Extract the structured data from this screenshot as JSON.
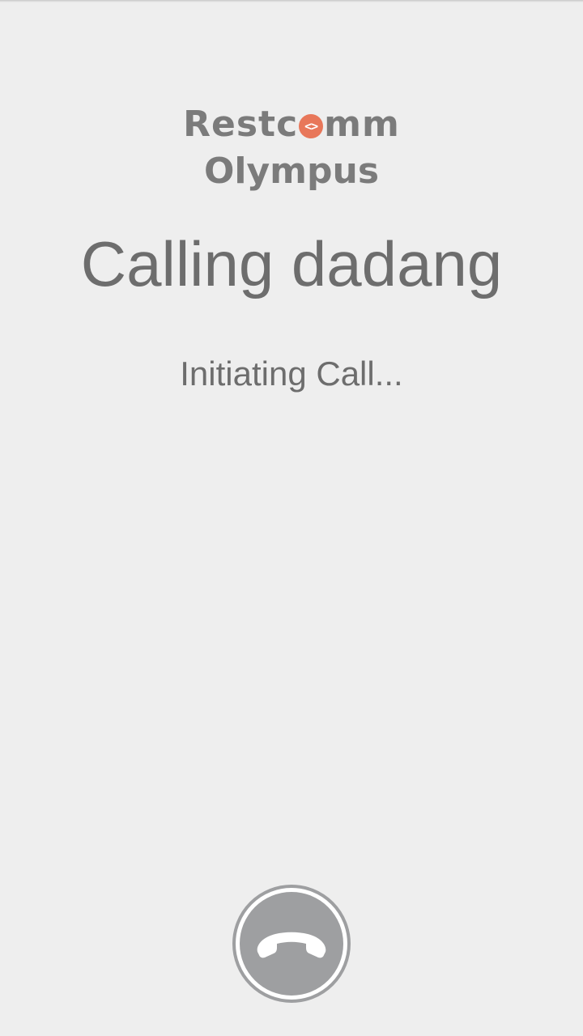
{
  "logo": {
    "line1_prefix": "Restc",
    "line1_mark": "<>",
    "line1_suffix": "mm",
    "line2": "Olympus",
    "mark_color": "#e8775a"
  },
  "call": {
    "title": "Calling dadang",
    "status": "Initiating Call..."
  },
  "controls": {
    "hangup_icon": "phone-hangup-icon",
    "button_color": "#9e9fa1"
  }
}
